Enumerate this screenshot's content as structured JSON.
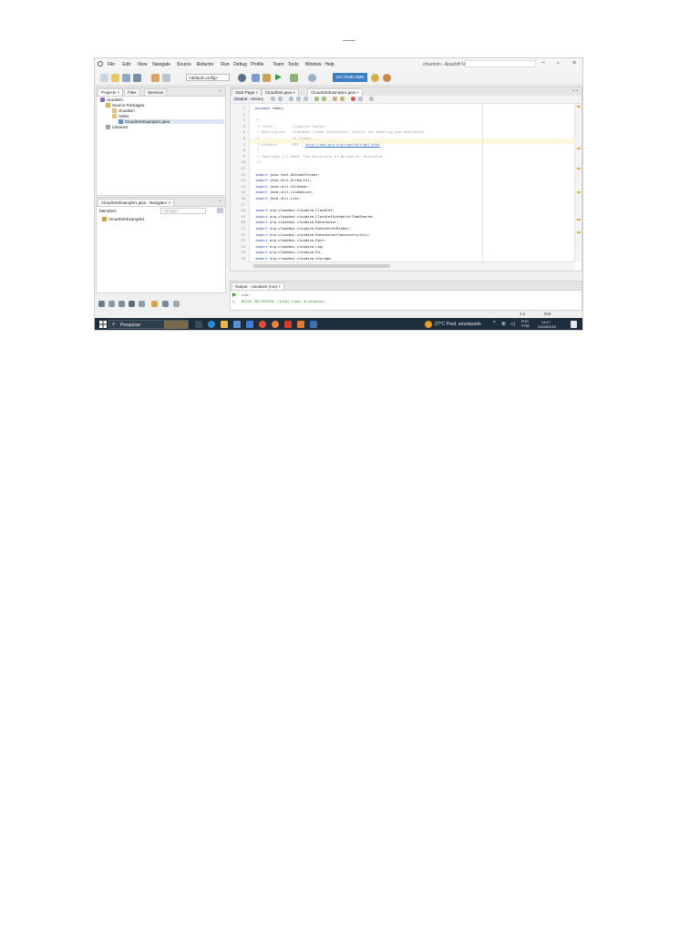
{
  "window": {
    "title": "cloudsim - Apache NetBeans IDE 17",
    "menu": [
      "File",
      "Edit",
      "View",
      "Navigate",
      "Source",
      "Refactor",
      "Run",
      "Debug",
      "Profile",
      "Team",
      "Tools",
      "Window",
      "Help"
    ]
  },
  "toolbar": {
    "config_select": "<default config>",
    "memory_label": "247.0/486.0MB"
  },
  "projects_panel": {
    "tabs": [
      "Projects ×",
      "Files",
      "Services"
    ],
    "tree": [
      {
        "label": "cloudsim",
        "icon": "project-icon"
      },
      {
        "label": "Source Packages",
        "icon": "package-folder-icon"
      },
      {
        "label": "cloudsim",
        "icon": "package-icon"
      },
      {
        "label": "redes",
        "icon": "package-icon"
      },
      {
        "label": "CloudSimExample1.java",
        "icon": "java-file-icon"
      },
      {
        "label": "Libraries",
        "icon": "library-icon"
      }
    ]
  },
  "navigator_panel": {
    "title": "CloudSimExample1.java - Navigator ×",
    "filter_label": "Members",
    "filter_value": "<empty>",
    "tree": [
      "CloudSimExample1"
    ]
  },
  "editor": {
    "tabs": [
      "Start Page ×",
      "CloudSim.java ×",
      "CloudSimExample1.java ×"
    ],
    "subtabs": [
      "Source",
      "History"
    ],
    "lines": [
      {
        "n": "1",
        "segments": [
          {
            "t": "package ",
            "c": "kw"
          },
          {
            "t": "redes;",
            "c": ""
          }
        ]
      },
      {
        "n": "2",
        "segments": []
      },
      {
        "n": "3",
        "segments": [
          {
            "t": "/*",
            "c": "cm"
          }
        ]
      },
      {
        "n": "4",
        "segments": [
          {
            "t": " * Title:         CloudSim Toolkit",
            "c": "cm"
          }
        ]
      },
      {
        "n": "5",
        "segments": [
          {
            "t": " * Description:   CloudSim (Cloud Simulation) Toolkit for Modeling and Simulation",
            "c": "cm"
          }
        ]
      },
      {
        "n": "6",
        "segments": [
          {
            "t": " *                of Clouds",
            "c": "cm"
          }
        ]
      },
      {
        "n": "7",
        "segments": [
          {
            "t": " * Licence:       GPL - ",
            "c": "cm"
          },
          {
            "t": "http://www.gnu.org/copyleft/gpl.html",
            "c": "url"
          }
        ]
      },
      {
        "n": "8",
        "segments": [
          {
            "t": " *",
            "c": "cm"
          }
        ]
      },
      {
        "n": "9",
        "segments": [
          {
            "t": " * Copyright (c) 2009, The University of Melbourne, Australia",
            "c": "cm"
          }
        ]
      },
      {
        "n": "10",
        "segments": [
          {
            "t": " */",
            "c": "cm"
          }
        ]
      },
      {
        "n": "11",
        "segments": []
      },
      {
        "n": "12",
        "segments": [
          {
            "t": "import ",
            "c": "kw"
          },
          {
            "t": "java.text.DecimalFormat;",
            "c": ""
          }
        ]
      },
      {
        "n": "13",
        "segments": [
          {
            "t": "import ",
            "c": "kw"
          },
          {
            "t": "java.util.ArrayList;",
            "c": ""
          }
        ]
      },
      {
        "n": "14",
        "segments": [
          {
            "t": "import ",
            "c": "kw"
          },
          {
            "t": "java.util.Calendar;",
            "c": ""
          }
        ]
      },
      {
        "n": "15",
        "segments": [
          {
            "t": "import ",
            "c": "kw"
          },
          {
            "t": "java.util.LinkedList;",
            "c": ""
          }
        ]
      },
      {
        "n": "16",
        "segments": [
          {
            "t": "import ",
            "c": "kw"
          },
          {
            "t": "java.util.List;",
            "c": ""
          }
        ]
      },
      {
        "n": "17",
        "segments": []
      },
      {
        "n": "18",
        "segments": [
          {
            "t": "import ",
            "c": "kw"
          },
          {
            "t": "org.cloudbus.cloudsim.Cloudlet;",
            "c": ""
          }
        ]
      },
      {
        "n": "19",
        "segments": [
          {
            "t": "import ",
            "c": "kw"
          },
          {
            "t": "org.cloudbus.cloudsim.CloudletSchedulerTimeShared;",
            "c": ""
          }
        ]
      },
      {
        "n": "20",
        "segments": [
          {
            "t": "import ",
            "c": "kw"
          },
          {
            "t": "org.cloudbus.cloudsim.Datacenter;",
            "c": ""
          }
        ]
      },
      {
        "n": "21",
        "segments": [
          {
            "t": "import ",
            "c": "kw"
          },
          {
            "t": "org.cloudbus.cloudsim.DatacenterBroker;",
            "c": ""
          }
        ]
      },
      {
        "n": "22",
        "segments": [
          {
            "t": "import ",
            "c": "kw"
          },
          {
            "t": "org.cloudbus.cloudsim.DatacenterCharacteristics;",
            "c": ""
          }
        ]
      },
      {
        "n": "23",
        "segments": [
          {
            "t": "import ",
            "c": "kw"
          },
          {
            "t": "org.cloudbus.cloudsim.Host;",
            "c": ""
          }
        ]
      },
      {
        "n": "24",
        "segments": [
          {
            "t": "import ",
            "c": "kw"
          },
          {
            "t": "org.cloudbus.cloudsim.Log;",
            "c": ""
          }
        ]
      },
      {
        "n": "25",
        "segments": [
          {
            "t": "import ",
            "c": "kw"
          },
          {
            "t": "org.cloudbus.cloudsim.Pe;",
            "c": ""
          }
        ]
      },
      {
        "n": "26",
        "segments": [
          {
            "t": "import ",
            "c": "kw"
          },
          {
            "t": "org.cloudbus.cloudsim.Storage;",
            "c": ""
          }
        ]
      }
    ]
  },
  "output_panel": {
    "tab_label": "Output - cloudsim (run) ×",
    "lines": [
      "run:",
      "BUILD SUCCESSFUL (total time: 0 seconds)"
    ]
  },
  "status_bar": {
    "position": "1:1",
    "mode": "INS"
  },
  "taskbar": {
    "search_placeholder": "Pesquisar",
    "weather": "27°C  Pred. ensolarado",
    "lang": "POR\nPTB2",
    "time": "14:17",
    "date": "23/03/2023"
  }
}
